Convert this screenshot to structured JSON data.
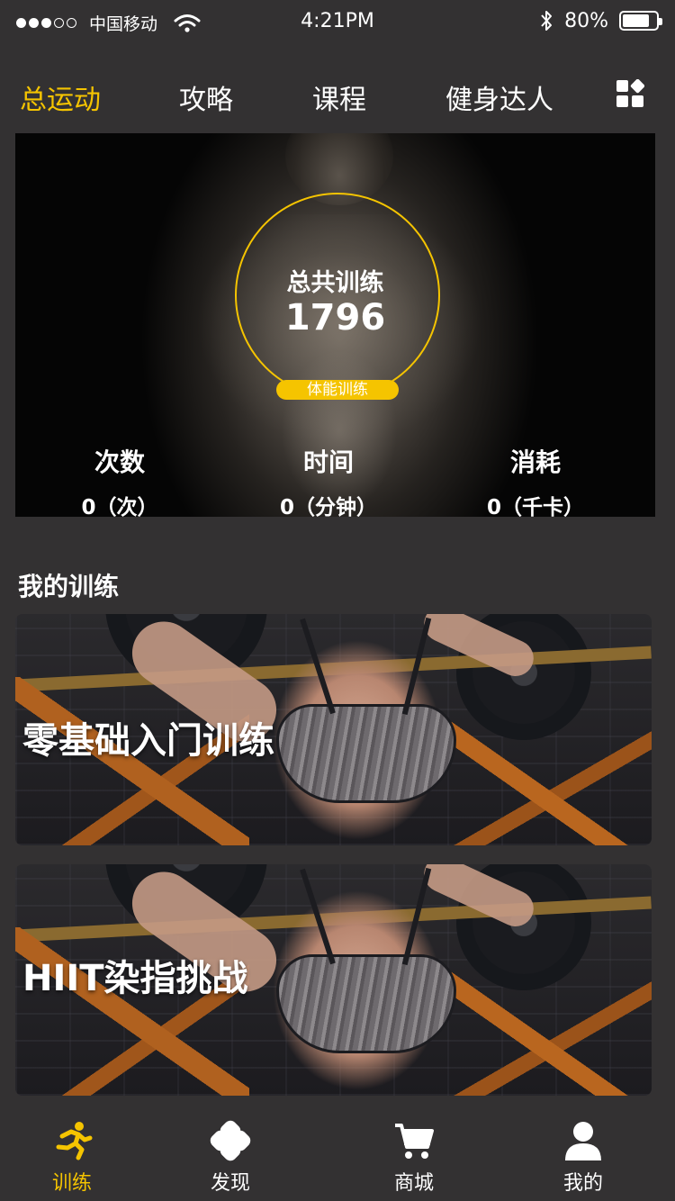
{
  "status_bar": {
    "carrier": "中国移动",
    "time": "4:21PM",
    "battery_percent": "80%",
    "battery_level": 0.8,
    "signal_bars_filled": 3,
    "signal_bars_total": 5
  },
  "top_tabs": [
    {
      "label": "总运动",
      "active": true
    },
    {
      "label": "攻略",
      "active": false
    },
    {
      "label": "课程",
      "active": false
    },
    {
      "label": "健身达人",
      "active": false
    }
  ],
  "hero": {
    "ring_title": "总共训练",
    "ring_value": "1796",
    "badge": "体能训练",
    "stats": [
      {
        "label": "次数",
        "value": "0（次）"
      },
      {
        "label": "时间",
        "value": "0（分钟）"
      },
      {
        "label": "消耗",
        "value": "0（千卡）"
      }
    ]
  },
  "section": {
    "title": "我的训练"
  },
  "cards": [
    {
      "title": "零基础入门训练"
    },
    {
      "title": "HIIT染指挑战"
    }
  ],
  "bottom_nav": [
    {
      "label": "训练",
      "icon": "running-icon",
      "active": true
    },
    {
      "label": "发现",
      "icon": "clover-icon",
      "active": false
    },
    {
      "label": "商城",
      "icon": "cart-icon",
      "active": false
    },
    {
      "label": "我的",
      "icon": "user-icon",
      "active": false
    }
  ],
  "colors": {
    "accent": "#f5c400",
    "background": "#333132"
  }
}
